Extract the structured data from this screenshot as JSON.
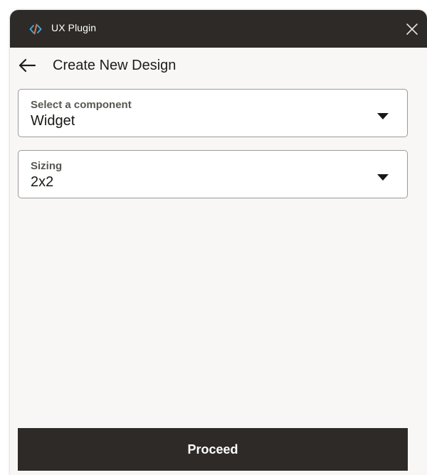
{
  "window": {
    "title": "UX Plugin",
    "logo_icon": "code-icon",
    "close_icon": "close-icon"
  },
  "header": {
    "back_icon": "arrow-left-icon",
    "title": "Create New Design"
  },
  "form": {
    "component_select": {
      "label": "Select a component",
      "value": "Widget",
      "icon": "caret-down-icon"
    },
    "sizing_select": {
      "label": "Sizing",
      "value": "2x2",
      "icon": "caret-down-icon"
    }
  },
  "footer": {
    "proceed_label": "Proceed"
  },
  "colors": {
    "titlebar_bg": "#2d2a27",
    "panel_bg": "#f8f7f6",
    "button_bg": "#2d2a27",
    "logo_accent_blue": "#38a8e8",
    "logo_accent_orange": "#e8743b"
  }
}
